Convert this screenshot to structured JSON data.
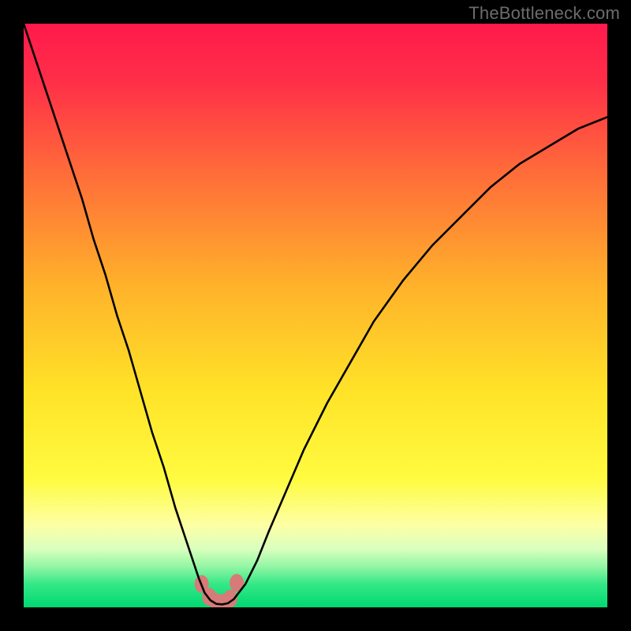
{
  "watermark": "TheBottleneck.com",
  "chart_data": {
    "type": "line",
    "title": "",
    "xlabel": "",
    "ylabel": "",
    "xlim": [
      0,
      100
    ],
    "ylim": [
      0,
      100
    ],
    "grid": false,
    "gradient_stops": [
      {
        "offset": 0.0,
        "color": "#ff1a4b"
      },
      {
        "offset": 0.1,
        "color": "#ff2f48"
      },
      {
        "offset": 0.25,
        "color": "#ff6a3a"
      },
      {
        "offset": 0.45,
        "color": "#ffb22a"
      },
      {
        "offset": 0.63,
        "color": "#ffe328"
      },
      {
        "offset": 0.78,
        "color": "#fffb40"
      },
      {
        "offset": 0.86,
        "color": "#fdffa6"
      },
      {
        "offset": 0.9,
        "color": "#d9ffbe"
      },
      {
        "offset": 0.93,
        "color": "#93f6a4"
      },
      {
        "offset": 0.96,
        "color": "#35e887"
      },
      {
        "offset": 1.0,
        "color": "#00d870"
      }
    ],
    "series": [
      {
        "name": "bottleneck-curve",
        "color": "#000000",
        "stroke_width": 2.6,
        "x": [
          0,
          2,
          4,
          6,
          8,
          10,
          12,
          14,
          16,
          18,
          20,
          22,
          24,
          26,
          28,
          30,
          31,
          32,
          33,
          34,
          35,
          36,
          38,
          40,
          42,
          45,
          48,
          52,
          56,
          60,
          65,
          70,
          75,
          80,
          85,
          90,
          95,
          100
        ],
        "y": [
          100,
          94,
          88,
          82,
          76,
          70,
          63,
          57,
          50,
          44,
          37,
          30,
          24,
          17,
          11,
          5,
          2.5,
          1.2,
          0.6,
          0.5,
          0.7,
          1.4,
          4,
          8,
          13,
          20,
          27,
          35,
          42,
          49,
          56,
          62,
          67,
          72,
          76,
          79,
          82,
          84
        ]
      },
      {
        "name": "trough-markers",
        "color": "#d77b78",
        "type": "scatter",
        "marker_radius": 9,
        "x": [
          30.5,
          31.8,
          33.0,
          34.2,
          35.4,
          36.5
        ],
        "y": [
          4.0,
          1.8,
          0.9,
          0.8,
          1.5,
          4.2
        ]
      }
    ],
    "annotations": []
  }
}
